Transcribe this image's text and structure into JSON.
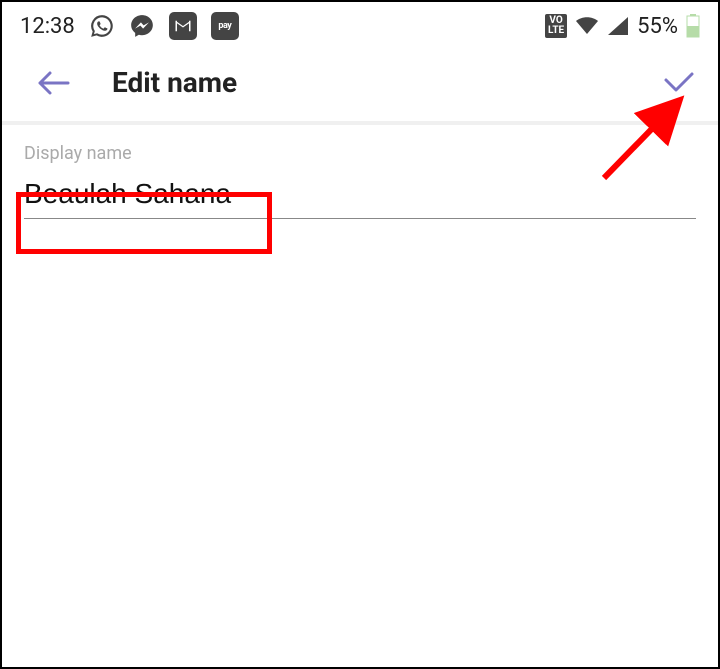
{
  "status_bar": {
    "time": "12:38",
    "battery": "55%",
    "volte_label": "VO\nLTE"
  },
  "app_bar": {
    "title": "Edit name"
  },
  "form": {
    "label": "Display name",
    "value": "Beaulah Sahana"
  }
}
